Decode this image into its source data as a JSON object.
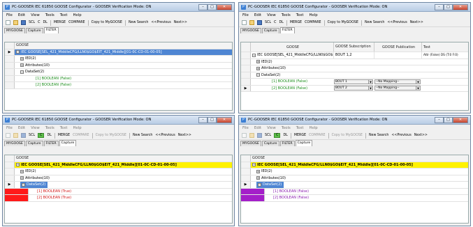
{
  "windows": [
    {
      "title": "PC-GOOSER  IEC 61850 GOOSE Configurator - GOOSER Verification Mode: ON",
      "menu": [
        "File",
        "Edit",
        "View",
        "Tools",
        "Text",
        "Help"
      ],
      "toolbar": {
        "scl": "SCL",
        "c": "C",
        "dl": "DL",
        "merge": "MERGE",
        "compare": "COMPARE",
        "copy": "Copy to MyGOOSE",
        "newsearch": "New Search",
        "previous": "<<Previous",
        "next": "Next>>"
      },
      "tabs": [
        "MYGOOSE",
        "Capture",
        "FILTER"
      ],
      "col_header": "GOOSE",
      "rows": {
        "goose": "IEC GOOSE[SEL_421_MiddleCFG/LLN0$GO$EIT_421_Middle][01-0C-CD-01-00-05]",
        "ied": "IED(2)",
        "attributes": "Attributes(10)",
        "dataset": "DataSet(2)",
        "item1": "[1] BOOLEAN  (False)",
        "item2": "[2] BOOLEAN  (False)"
      }
    },
    {
      "title": "PC-GOOSER  IEC 61850 GOOSE Configurator - GOOSER Verification Mode: ON",
      "menu": [
        "File",
        "Edit",
        "View",
        "Tools",
        "Text",
        "Help"
      ],
      "toolbar": {
        "scl": "SCL",
        "c": "C",
        "dl": "DL",
        "merge": "MERGE",
        "compare": "COMPARE",
        "copy": "Copy to MyGOOSE",
        "newsearch": "New Search",
        "previous": "<<Previous",
        "next": "Next>>"
      },
      "tabs": [
        "MYGOOSE",
        "Capture",
        "FILTER"
      ],
      "columns": {
        "goose": "GOOSE",
        "subscription": "GOOSE Subscription",
        "publication": "GOOSE Publication",
        "test": "Test"
      },
      "rows": {
        "goose": "IEC GOOSE[SEL_421_MiddleCFG/LLN0$GO$",
        "subscription_value": "BOUT 1,2",
        "test_value": "Attr (False) DS (T:0 F:0)",
        "ied": "IED(2)",
        "attributes": "Attributes(10)",
        "dataset": "DataSet(2)",
        "item1": "[1] BOOLEAN  (False)",
        "item2": "[2] BOOLEAN  (False)",
        "item1_sub": "BOUT 1",
        "item2_sub": "BOUT 2",
        "item1_pub": "--No Mapping--",
        "item2_pub": "--No Mapping--"
      }
    },
    {
      "title": "PC-GOOSER  IEC 61850 GOOSE Configurator - GOOSER Verification Mode: ON",
      "menu": [
        "File",
        "Edit",
        "View",
        "Tools",
        "Text",
        "Help"
      ],
      "toolbar": {
        "scl": "SCL",
        "c": "C",
        "dl": "DL",
        "merge": "MERGE",
        "compare": "COMPARE",
        "copy": "Copy to MyGOOSE",
        "newsearch": "New Search",
        "previous": "<<Previous",
        "next": "Next>>"
      },
      "tabs": [
        "MYGOOSE",
        "Capture",
        "FILTER",
        "Capture"
      ],
      "col_header": "GOOSE",
      "rows": {
        "goose": "IEC GOOSE[SEL_421_MiddleCFG/LLN0$GO$EIT_421_Middle][01-0C-CD-01-00-05]",
        "ied": "IED(2)",
        "attributes": "Attributes(10)",
        "dataset": "DataSet(2)",
        "item1": "[1] BOOLEAN   (True)",
        "item2": "[2] BOOLEAN   (True)"
      }
    },
    {
      "title": "PC-GOOSER  IEC 61850 GOOSE Configurator - GOOSER Verification Mode: ON",
      "menu": [
        "File",
        "Edit",
        "View",
        "Tools",
        "Text",
        "Help"
      ],
      "toolbar": {
        "scl": "SCL",
        "c": "C",
        "dl": "DL",
        "merge": "MERGE",
        "compare": "COMPARE",
        "copy": "Copy to MyGOOSE",
        "newsearch": "New Search",
        "previous": "<<Previous",
        "next": "Next>>"
      },
      "tabs": [
        "MYGOOSE",
        "Capture",
        "FILTER",
        "Capture"
      ],
      "col_header": "GOOSE",
      "rows": {
        "goose": "IEC GOOSE[SEL_421_MiddleCFG/LLN0$GO$EIT_421_Middle][01-0C-CD-01-00-05]",
        "ied": "IED(2)",
        "attributes": "Attributes(10)",
        "dataset": "DataSet(2)",
        "item1": "[1] BOOLEAN   (False)",
        "item2": "[2] BOOLEAN   (False)"
      }
    }
  ],
  "colors": {
    "selection": "#4f86d3",
    "highlight_yellow": "#fff200",
    "true_red": "#ff1a1a",
    "false_purple": "#a41fc9",
    "false_green": "#1f8f1f"
  }
}
